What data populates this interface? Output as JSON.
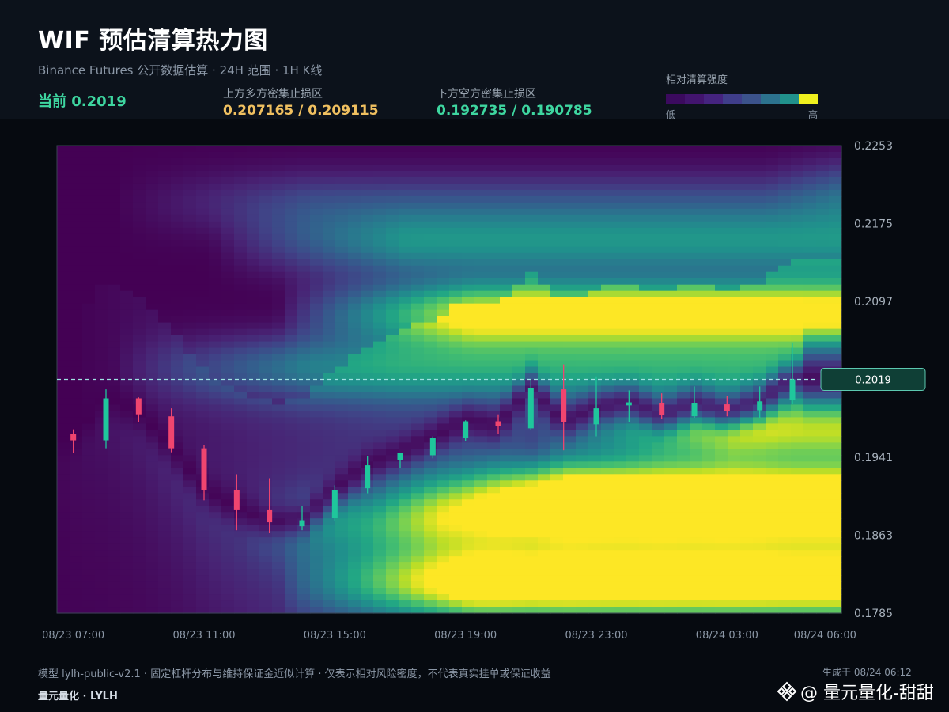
{
  "header": {
    "title": "WIF 预估清算热力图",
    "subtitle": "Binance Futures 公开数据估算 · 24H 范围 · 1H K线",
    "current_label": "当前 0.2019",
    "upper": {
      "label": "上方多方密集止损区",
      "value": "0.207165 / 0.209115"
    },
    "lower": {
      "label": "下方空方密集止损区",
      "value": "0.192735 / 0.190785"
    }
  },
  "legend": {
    "title": "相对清算强度",
    "low": "低",
    "high": "高",
    "colors": [
      "#3b0a5e",
      "#42146e",
      "#45237f",
      "#3f3d8a",
      "#3b528b",
      "#2c728e",
      "#21918c",
      "#f0f01e"
    ]
  },
  "footer": {
    "note": "模型 lylh-public-v2.1 · 固定杠杆分布与维持保证金近似计算 · 仅表示相对风险密度，不代表真实挂单或保证收益",
    "brand": "量元量化 · LYLH",
    "generated": "生成于 08/24 06:12",
    "watermark": "@ 量元量化-甜甜"
  },
  "chart_data": {
    "type": "heatmap",
    "title": "WIF 预估清算热力图",
    "ylim": [
      0.1785,
      0.2253
    ],
    "y_ticks": [
      "0.2253",
      "0.2175",
      "0.2097",
      "0.2019",
      "0.1941",
      "0.1863",
      "0.1785"
    ],
    "y_tick_values": [
      0.2253,
      0.2175,
      0.2097,
      0.2019,
      0.1941,
      0.1863,
      0.1785
    ],
    "x_ticks": [
      "08/23 07:00",
      "08/23 11:00",
      "08/23 15:00",
      "08/23 19:00",
      "08/23 23:00",
      "08/24 03:00",
      "08/24 06:00"
    ],
    "current_price": 0.2019,
    "current_price_label": "0.2019",
    "colors": {
      "up": "#1fc79c",
      "down": "#f0456f",
      "price_line": "#9fe3e3"
    },
    "candles": [
      {
        "time": "08/23 07:00",
        "open": 0.1964,
        "high": 0.1969,
        "low": 0.1945,
        "close": 0.1958
      },
      {
        "time": "08/23 08:00",
        "open": 0.1958,
        "high": 0.2009,
        "low": 0.195,
        "close": 0.2
      },
      {
        "time": "08/23 09:00",
        "open": 0.2,
        "high": 0.2001,
        "low": 0.1976,
        "close": 0.1984
      },
      {
        "time": "08/23 10:00",
        "open": 0.1982,
        "high": 0.199,
        "low": 0.1946,
        "close": 0.195
      },
      {
        "time": "08/23 11:00",
        "open": 0.195,
        "high": 0.1953,
        "low": 0.1898,
        "close": 0.1908
      },
      {
        "time": "08/23 12:00",
        "open": 0.1908,
        "high": 0.1924,
        "low": 0.1868,
        "close": 0.1888
      },
      {
        "time": "08/23 13:00",
        "open": 0.1888,
        "high": 0.192,
        "low": 0.1865,
        "close": 0.1876
      },
      {
        "time": "08/23 14:00",
        "open": 0.1872,
        "high": 0.1892,
        "low": 0.1868,
        "close": 0.1878
      },
      {
        "time": "08/23 15:00",
        "open": 0.188,
        "high": 0.1913,
        "low": 0.1877,
        "close": 0.1908
      },
      {
        "time": "08/23 16:00",
        "open": 0.191,
        "high": 0.1942,
        "low": 0.1905,
        "close": 0.1933
      },
      {
        "time": "08/23 17:00",
        "open": 0.1938,
        "high": 0.1941,
        "low": 0.193,
        "close": 0.1945
      },
      {
        "time": "08/23 18:00",
        "open": 0.1943,
        "high": 0.1962,
        "low": 0.194,
        "close": 0.196
      },
      {
        "time": "08/23 19:00",
        "open": 0.196,
        "high": 0.1978,
        "low": 0.1957,
        "close": 0.1977
      },
      {
        "time": "08/23 20:00",
        "open": 0.1977,
        "high": 0.1984,
        "low": 0.1964,
        "close": 0.1972
      },
      {
        "time": "08/23 21:00",
        "open": 0.197,
        "high": 0.2019,
        "low": 0.1968,
        "close": 0.201
      },
      {
        "time": "08/23 22:00",
        "open": 0.2009,
        "high": 0.2034,
        "low": 0.1948,
        "close": 0.1976
      },
      {
        "time": "08/23 23:00",
        "open": 0.1974,
        "high": 0.2022,
        "low": 0.1962,
        "close": 0.199
      },
      {
        "time": "08/24 00:00",
        "open": 0.1993,
        "high": 0.2008,
        "low": 0.1976,
        "close": 0.1996
      },
      {
        "time": "08/24 01:00",
        "open": 0.1995,
        "high": 0.2005,
        "low": 0.1979,
        "close": 0.1983
      },
      {
        "time": "08/24 02:00",
        "open": 0.1982,
        "high": 0.2012,
        "low": 0.198,
        "close": 0.1995
      },
      {
        "time": "08/24 03:00",
        "open": 0.1994,
        "high": 0.2002,
        "low": 0.1982,
        "close": 0.1987
      },
      {
        "time": "08/24 04:00",
        "open": 0.1988,
        "high": 0.2012,
        "low": 0.198,
        "close": 0.1997
      },
      {
        "time": "08/24 05:00",
        "open": 0.1998,
        "high": 0.2055,
        "low": 0.1994,
        "close": 0.2019
      },
      {
        "time": "08/24 06:00",
        "open": 0.2019,
        "high": 0.2028,
        "low": 0.201,
        "close": 0.2019
      }
    ],
    "liquidation_bands": [
      {
        "price": 0.2085,
        "start": 7,
        "end": 24,
        "intensity": 1.0
      },
      {
        "price": 0.2155,
        "start": 5,
        "end": 24,
        "intensity": 0.5
      },
      {
        "price": 0.2195,
        "start": 2,
        "end": 24,
        "intensity": 0.22
      },
      {
        "price": 0.221,
        "start": 22,
        "end": 24,
        "intensity": 0.4
      },
      {
        "price": 0.203,
        "start": 2,
        "end": 22,
        "intensity": 0.45
      },
      {
        "price": 0.1968,
        "start": 15,
        "end": 24,
        "intensity": 0.75
      },
      {
        "price": 0.1905,
        "start": 10,
        "end": 24,
        "intensity": 1.0
      },
      {
        "price": 0.1875,
        "start": 6,
        "end": 24,
        "intensity": 0.7
      },
      {
        "price": 0.1825,
        "start": 7,
        "end": 24,
        "intensity": 0.85
      },
      {
        "price": 0.18,
        "start": 7,
        "end": 24,
        "intensity": 0.6
      }
    ]
  }
}
